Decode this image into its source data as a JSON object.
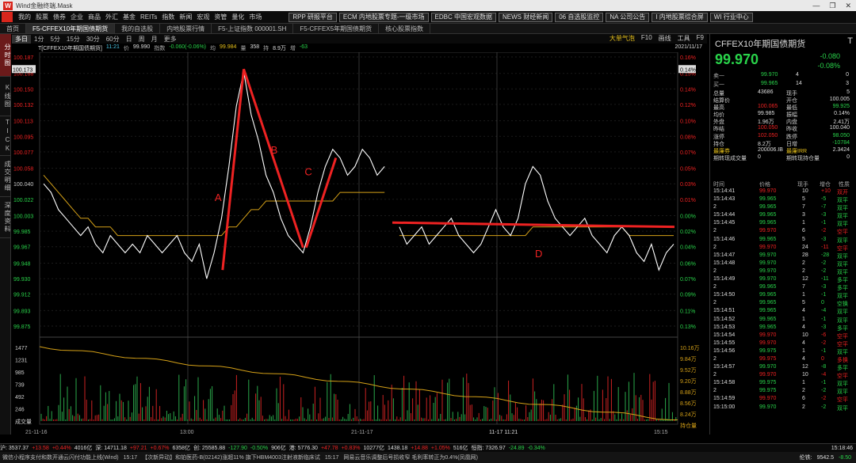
{
  "window": {
    "title": "Wind金融终端.Mask",
    "controls": [
      "—",
      "❐",
      "✕"
    ]
  },
  "menu": {
    "items": [
      "我的",
      "股票",
      "债券",
      "企业",
      "商品",
      "外汇",
      "基金",
      "REITs",
      "指数",
      "新闻",
      "宏观",
      "资管",
      "量化",
      "市场"
    ],
    "chips": [
      "RPP 研报平台",
      "ECM 内地股票专题-一级市场",
      "EDBC 中国宏观数据",
      "NEWS 财经新闻",
      "06 自选股监控",
      "NA 公司公告",
      "I 内地股票综合屏",
      "WI 行业中心"
    ]
  },
  "tabs": [
    "首页",
    "F5-CFFEX10年期国债期货",
    "我的自选股",
    "内地股票行情",
    "F5-上证指数 000001.SH",
    "F5-CFFEX5年期国债期货",
    "核心股票指数"
  ],
  "sidebar": [
    "分时图",
    "K线图",
    "TICK",
    "成交明细",
    "深度资料"
  ],
  "periods": [
    "多日",
    "1分",
    "5分",
    "15分",
    "30分",
    "60分",
    "日",
    "周",
    "月",
    "更多"
  ],
  "period_right": [
    "大单气泡",
    "F10",
    "画线",
    "工具",
    "F9"
  ],
  "infoline": {
    "code": "T[CFFEX10年期国债期货]",
    "time": "11:21",
    "price_label": "价",
    "price": "99.990",
    "index_label": "指数",
    "index": "-0.060(-0.06%)",
    "avg_label": "均",
    "avg": "99.984",
    "vol_label": "量",
    "vol": "358",
    "hold_label": "持",
    "hold": "8.9万",
    "chg_label": "增",
    "chg": "-63",
    "date": "2021/11/17"
  },
  "chart_data": {
    "type": "line",
    "y_left_ticks": [
      "100.187",
      "100.168",
      "100.150",
      "100.132",
      "100.113",
      "100.095",
      "100.077",
      "100.058",
      "100.040",
      "100.022",
      "100.003",
      "99.985",
      "99.967",
      "99.948",
      "99.930",
      "99.912",
      "99.893",
      "99.875"
    ],
    "y_right_ticks": [
      "0.16%",
      "0.15%",
      "0.14%",
      "0.12%",
      "0.10%",
      "0.08%",
      "0.07%",
      "0.05%",
      "0.03%",
      "0.01%",
      "0.00%",
      "0.02%",
      "0.04%",
      "0.06%",
      "0.07%",
      "0.09%",
      "0.11%",
      "0.13%"
    ],
    "current_left": "100.173",
    "current_right": "0.14%",
    "vol_ticks_left": [
      "1477",
      "1231",
      "985",
      "739",
      "492",
      "246",
      "成交量"
    ],
    "vol_ticks_right": [
      "10.16万",
      "9.84万",
      "9.52万",
      "9.20万",
      "8.88万",
      "8.56万",
      "8.24万",
      "持仓量"
    ],
    "x_ticks": [
      "21-11-16",
      "13:00",
      "21-11-17",
      "11-17 11:21",
      "15:15"
    ],
    "annotations": [
      "A",
      "B",
      "C",
      "D"
    ],
    "price_series": [
      100.04,
      100.03,
      100.01,
      100.0,
      99.99,
      99.98,
      99.99,
      99.97,
      99.96,
      99.98,
      99.97,
      99.96,
      99.97,
      99.96,
      99.98,
      99.97,
      99.96,
      99.97,
      99.98,
      99.96,
      99.95,
      99.97,
      99.93,
      99.96,
      100.0,
      100.06,
      100.13,
      100.17,
      100.12,
      100.09,
      100.05,
      100.03,
      100.0,
      99.98,
      99.97,
      99.96,
      99.99,
      100.03,
      100.06,
      100.08,
      100.07,
      100.05,
      100.06,
      100.08,
      100.07,
      100.05,
      100.06,
      null,
      99.99,
      99.97,
      99.98,
      99.99,
      99.97,
      99.98,
      99.99,
      100.0,
      99.98,
      99.97,
      99.96,
      99.97,
      99.99,
      100.01,
      99.99,
      99.98,
      100.0,
      100.04,
      100.06,
      100.05,
      100.02,
      100.0,
      99.99,
      99.98,
      99.99,
      100.0,
      99.98,
      99.97,
      99.96,
      99.98,
      99.99,
      99.98,
      99.96,
      99.95,
      99.97,
      99.94,
      99.96,
      99.97
    ],
    "avg_series": [
      100.05,
      100.04,
      100.03,
      100.02,
      100.01,
      100.0,
      100.0,
      99.99,
      99.99,
      99.99,
      99.98,
      99.98,
      99.98,
      99.98,
      99.98,
      99.98,
      99.98,
      99.98,
      99.98,
      99.98,
      99.98,
      99.98,
      99.98,
      99.98,
      99.98,
      99.99,
      99.99,
      100.0,
      100.01,
      100.01,
      100.02,
      100.02,
      100.02,
      100.02,
      100.02,
      100.02,
      100.02,
      100.02,
      100.02,
      100.02,
      100.03,
      100.03,
      100.03,
      100.03,
      100.03,
      100.03,
      100.03,
      null,
      99.98,
      99.98,
      99.98,
      99.98,
      99.98,
      99.98,
      99.98,
      99.98,
      99.98,
      99.98,
      99.98,
      99.98,
      99.98,
      99.98,
      99.98,
      99.98,
      99.98,
      99.98,
      99.99,
      99.99,
      99.99,
      99.99,
      99.99,
      99.99,
      99.99,
      99.99,
      99.99,
      99.99,
      99.99,
      99.99,
      99.99,
      99.98,
      99.98,
      99.98,
      99.98,
      99.98,
      99.98,
      99.98
    ]
  },
  "quote": {
    "name": "CFFEX10年期国债期货",
    "flag": "T",
    "price": "99.970",
    "change": "-0.080",
    "change_pct": "-0.08%",
    "ask": [
      "卖一",
      "99.970",
      "4",
      "0"
    ],
    "bid": [
      "买一",
      "99.965",
      "14",
      "3"
    ],
    "stats": [
      [
        "总量",
        "43686",
        "现手",
        "5"
      ],
      [
        "结算价",
        "",
        "开仓",
        "100.005"
      ],
      [
        "最高",
        "100.065",
        "最低",
        "99.925"
      ],
      [
        "均价",
        "99.985",
        "振幅",
        "0.14%"
      ],
      [
        "外盘",
        "1.96万",
        "内盘",
        "2.41万"
      ],
      [
        "昨结",
        "100.050",
        "昨收",
        "100.040"
      ],
      [
        "涨停",
        "102.050",
        "跌停",
        "98.050"
      ],
      [
        "持仓",
        "8.2万",
        "日增",
        "-10784"
      ],
      [
        "最廉券",
        "200006.IB",
        "最廉IRR",
        "2.3424"
      ],
      [
        "期转现成交量",
        "0",
        "期转现持仓量",
        "0"
      ]
    ],
    "trade_headers": [
      "时间",
      "价格",
      "现手",
      "增仓",
      "性质"
    ],
    "trades": [
      [
        "15:14:41",
        "99.970",
        "10",
        "+10",
        "双开",
        "r"
      ],
      [
        "15:14:43",
        "99.965",
        "5",
        "-5",
        "双平",
        "g"
      ],
      [
        "2",
        "99.965",
        "7",
        "-7",
        "双平",
        "g"
      ],
      [
        "15:14:44",
        "99.965",
        "3",
        "-3",
        "双平",
        "g"
      ],
      [
        "15:14:45",
        "99.965",
        "1",
        "-1",
        "双平",
        "g"
      ],
      [
        "2",
        "99.970",
        "6",
        "-2",
        "空平",
        "r"
      ],
      [
        "15:14:46",
        "99.965",
        "5",
        "-3",
        "双平",
        "g"
      ],
      [
        "2",
        "99.970",
        "24",
        "-11",
        "空平",
        "r"
      ],
      [
        "15:14:47",
        "99.970",
        "28",
        "-28",
        "双平",
        "g"
      ],
      [
        "15:14:48",
        "99.970",
        "2",
        "-2",
        "双平",
        "g"
      ],
      [
        "2",
        "99.970",
        "2",
        "-2",
        "双平",
        "g"
      ],
      [
        "15:14:49",
        "99.970",
        "12",
        "-11",
        "多平",
        "g"
      ],
      [
        "2",
        "99.965",
        "7",
        "-3",
        "多平",
        "g"
      ],
      [
        "15:14:50",
        "99.965",
        "1",
        "-1",
        "双平",
        "g"
      ],
      [
        "2",
        "99.965",
        "5",
        "0",
        "空换",
        "g"
      ],
      [
        "15:14:51",
        "99.965",
        "4",
        "-4",
        "双平",
        "g"
      ],
      [
        "15:14:52",
        "99.965",
        "1",
        "-1",
        "双平",
        "g"
      ],
      [
        "15:14:53",
        "99.965",
        "4",
        "-3",
        "多平",
        "g"
      ],
      [
        "15:14:54",
        "99.970",
        "10",
        "-6",
        "空平",
        "r"
      ],
      [
        "15:14:55",
        "99.970",
        "4",
        "-2",
        "空平",
        "r"
      ],
      [
        "15:14:56",
        "99.975",
        "1",
        "-1",
        "双平",
        "g"
      ],
      [
        "2",
        "99.975",
        "4",
        "0",
        "多换",
        "r"
      ],
      [
        "15:14:57",
        "99.970",
        "12",
        "-8",
        "多平",
        "g"
      ],
      [
        "2",
        "99.970",
        "10",
        "-4",
        "空平",
        "r"
      ],
      [
        "15:14:58",
        "99.975",
        "1",
        "-1",
        "双平",
        "g"
      ],
      [
        "2",
        "99.975",
        "2",
        "-2",
        "双平",
        "g"
      ],
      [
        "15:14:59",
        "99.970",
        "6",
        "-2",
        "空平",
        "r"
      ],
      [
        "15:15:00",
        "99.970",
        "2",
        "-2",
        "双平",
        "g"
      ]
    ]
  },
  "bottom": {
    "items": [
      [
        "沪: 3537.37",
        "w"
      ],
      [
        "+13.58",
        "r"
      ],
      [
        "+0.44%",
        "r"
      ],
      [
        "4016亿",
        "w"
      ],
      [
        "深: 14711.18",
        "w"
      ],
      [
        "+97.21",
        "r"
      ],
      [
        "+0.67%",
        "r"
      ],
      [
        "6358亿",
        "w"
      ],
      [
        "创: 25585.88",
        "w"
      ],
      [
        "-127.90",
        "g"
      ],
      [
        "-0.50%",
        "g"
      ],
      [
        "906亿",
        "w"
      ],
      [
        "港: 5776.30",
        "w"
      ],
      [
        "+47.78",
        "r"
      ],
      [
        "+0.83%",
        "r"
      ],
      [
        "10277亿",
        "w"
      ],
      [
        "1438.18",
        "w"
      ],
      [
        "+14.88",
        "r"
      ],
      [
        "+1.05%",
        "r"
      ],
      [
        "516亿",
        "w"
      ],
      [
        "恒指: 7326.97",
        "w"
      ],
      [
        "-24.89",
        "g"
      ],
      [
        "-0.34%",
        "g"
      ]
    ],
    "time": "15:18:46"
  },
  "news": {
    "items": [
      "微信小程序支付和数开通云闪付功能上线(Wind)",
      "15:17",
      "【次新异动】和铂医药-B(02142)涨超11% 旗下HBM4003注射液新临床试",
      "15:17",
      "网易云音乐调整后号损收窄 毛利率转正为0.4%(凤凰网)"
    ],
    "right": [
      "伦铁:",
      "9542.5",
      "-8.50"
    ]
  }
}
